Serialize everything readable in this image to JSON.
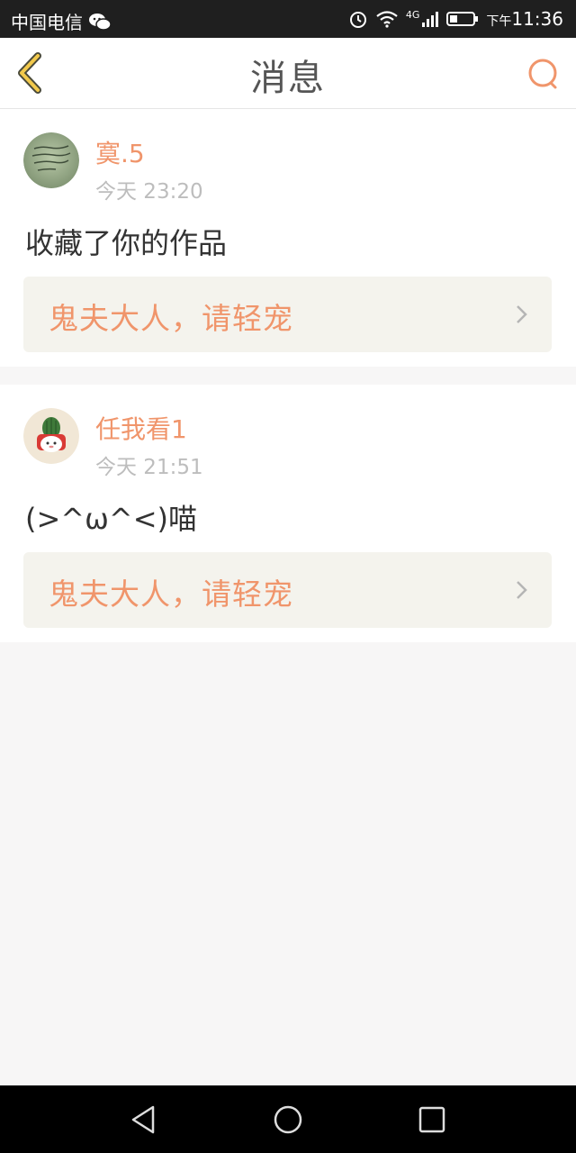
{
  "status_bar": {
    "carrier": "中国电信",
    "network": "4G",
    "ampm": "下午",
    "time": "11:36",
    "icons": [
      "wechat-icon",
      "alarm-icon",
      "wifi-icon",
      "signal-icon",
      "battery-icon"
    ]
  },
  "header": {
    "title": "消息",
    "back_icon": "chevron-left-icon",
    "search_icon": "search-icon",
    "accent_color": "#f0956b"
  },
  "messages": [
    {
      "username": "寞.5",
      "time": "今天 23:20",
      "text": "收藏了你的作品",
      "work_title": "鬼夫大人，请轻宠"
    },
    {
      "username": "任我看1",
      "time": "今天 21:51",
      "text": "(>^ω^<)喵",
      "work_title": "鬼夫大人，请轻宠"
    }
  ],
  "nav_bar": {
    "icons": [
      "nav-back-icon",
      "nav-home-icon",
      "nav-recent-icon"
    ]
  }
}
